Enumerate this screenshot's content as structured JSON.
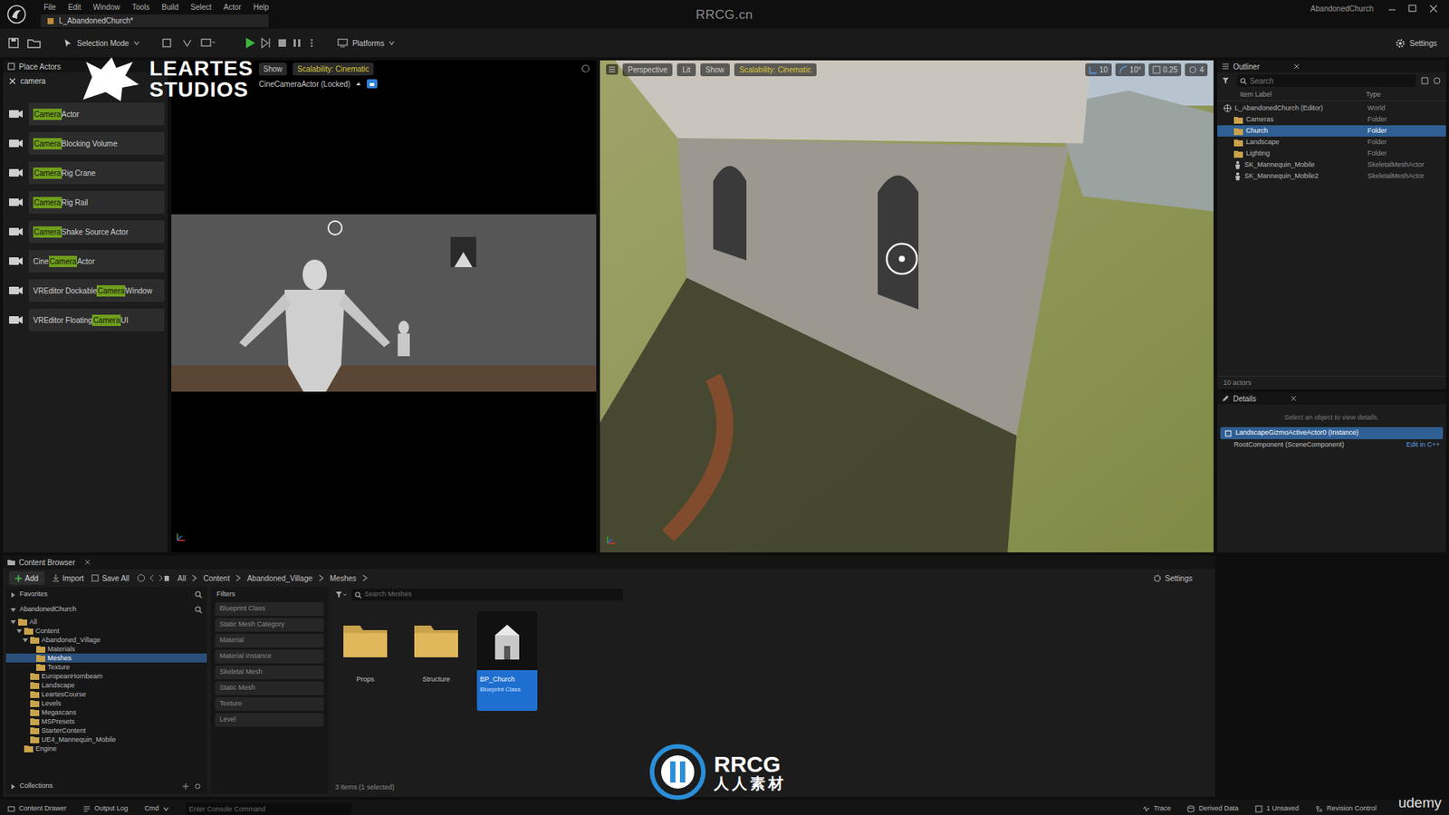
{
  "watermark": {
    "site": "RRCG.cn",
    "logo_top": "LEARTES",
    "logo_bottom": "STUDIOS",
    "badge": "RRCG",
    "badge_cn": "人人素材",
    "udemy": "udemy"
  },
  "window": {
    "level_tab": "L_AbandonedChurch*",
    "project": "AbandonedChurch"
  },
  "menu": [
    "File",
    "Edit",
    "Window",
    "Tools",
    "Build",
    "Select",
    "Actor",
    "Help"
  ],
  "toolbar": {
    "mode": "Selection Mode",
    "platforms": "Platforms",
    "settings": "Settings"
  },
  "place_actors": {
    "title": "Place Actors",
    "search": "camera",
    "items": [
      {
        "before": "",
        "match": "Camera",
        "after": " Actor"
      },
      {
        "before": "",
        "match": "Camera",
        "after": " Blocking Volume"
      },
      {
        "before": "",
        "match": "Camera",
        "after": " Rig Crane"
      },
      {
        "before": "",
        "match": "Camera",
        "after": " Rig Rail"
      },
      {
        "before": "",
        "match": "Camera",
        "after": " Shake Source Actor"
      },
      {
        "before": "Cine ",
        "match": "Camera",
        "after": " Actor"
      },
      {
        "before": "VREditor Dockable ",
        "match": "Camera",
        "after": " Window"
      },
      {
        "before": "VREditor Floating ",
        "match": "Camera",
        "after": " UI"
      }
    ]
  },
  "cine_viewport": {
    "show": "Show",
    "scalability": "Scalability: Cinematic",
    "pilot": "CineCameraActor (Locked)"
  },
  "main_viewport": {
    "view": "Perspective",
    "lit": "Lit",
    "show": "Show",
    "scalability": "Scalability: Cinematic",
    "snaps": [
      "10",
      "10°",
      "0.25",
      "4"
    ]
  },
  "outliner": {
    "title": "Outliner",
    "search": "Search",
    "columns": [
      "Item Label",
      "Type"
    ],
    "rows": [
      {
        "label": "L_AbandonedChurch (Editor)",
        "type": "World",
        "kind": "world",
        "selected": false,
        "children": [
          {
            "label": "Cameras",
            "type": "Folder",
            "kind": "folder",
            "selected": false
          },
          {
            "label": "Church",
            "type": "Folder",
            "kind": "folder",
            "selected": true
          },
          {
            "label": "Landscape",
            "type": "Folder",
            "kind": "folder",
            "selected": false
          },
          {
            "label": "Lighting",
            "type": "Folder",
            "kind": "folder",
            "selected": false
          },
          {
            "label": "SK_Mannequin_Mobile",
            "type": "SkeletalMeshActor",
            "kind": "actor",
            "selected": false
          },
          {
            "label": "SK_Mannequin_Mobile2",
            "type": "SkeletalMeshActor",
            "kind": "actor",
            "selected": false
          }
        ]
      }
    ],
    "count": "10 actors"
  },
  "details": {
    "title": "Details",
    "hint": "Select an object to view details.",
    "instance": "LandscapeGizmoActiveActor0 (Instance)",
    "component": "RootComponent (SceneComponent)",
    "edit": "Edit in C++"
  },
  "content_browser": {
    "tab": "Content Browser",
    "add": "Add",
    "import": "Import",
    "save_all": "Save All",
    "path": [
      "All",
      "Content",
      "Abandoned_Village",
      "Meshes"
    ],
    "settings": "Settings",
    "favorites": "Favorites",
    "project": "AbandonedChurch",
    "tree": [
      {
        "label": "All",
        "selected": false,
        "children": [
          {
            "label": "Content",
            "selected": false,
            "children": [
              {
                "label": "Abandoned_Village",
                "selected": false,
                "children": [
                  {
                    "label": "Materials",
                    "selected": false
                  },
                  {
                    "label": "Meshes",
                    "selected": true
                  },
                  {
                    "label": "Texture",
                    "selected": false
                  }
                ]
              },
              {
                "label": "EuropeanHornbeam",
                "selected": false
              },
              {
                "label": "Landscape",
                "selected": false
              },
              {
                "label": "LeartesCourse",
                "selected": false
              },
              {
                "label": "Levels",
                "selected": false
              },
              {
                "label": "Megascans",
                "selected": false
              },
              {
                "label": "MSPresets",
                "selected": false
              },
              {
                "label": "StarterContent",
                "selected": false
              },
              {
                "label": "UE4_Mannequin_Mobile",
                "selected": false
              }
            ]
          },
          {
            "label": "Engine",
            "selected": false
          }
        ]
      }
    ],
    "collections": "Collections",
    "filters_title": "Filters",
    "filters": [
      "Blueprint Class",
      "Static Mesh Category",
      "Material",
      "Material Instance",
      "Skeletal Mesh",
      "Static Mesh",
      "Texture",
      "Level"
    ],
    "search": "Search Meshes",
    "assets": [
      {
        "name": "Props",
        "kind": "folder",
        "type": "",
        "selected": false
      },
      {
        "name": "Structure",
        "kind": "folder",
        "type": "",
        "selected": false
      },
      {
        "name": "BP_Church",
        "kind": "blueprint",
        "type": "Blueprint Class",
        "selected": true
      }
    ],
    "count": "3 items (1 selected)"
  },
  "status_bar": {
    "drawer": "Content Drawer",
    "output": "Output Log",
    "cmd": "Cmd",
    "console": "Enter Console Command",
    "trace": "Trace",
    "derived": "Derived Data",
    "unsaved": "1 Unsaved",
    "revision": "Revision Control"
  }
}
